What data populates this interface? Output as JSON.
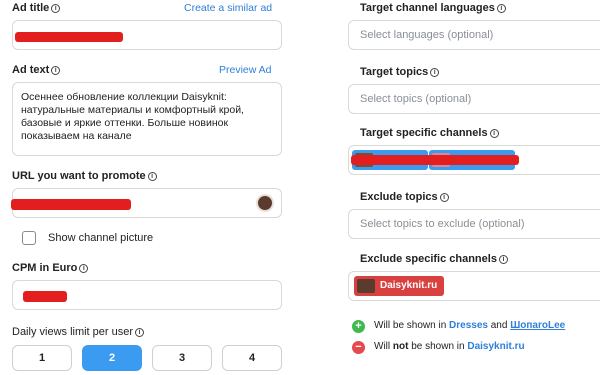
{
  "left": {
    "ad_title": {
      "label": "Ad title",
      "link": "Create a similar ad"
    },
    "ad_text": {
      "label": "Ad text",
      "link": "Preview Ad",
      "lines": [
        "Осеннее обновление коллекции Daisyknit:",
        "натуральные материалы и комфортный крой,",
        "базовые и яркие оттенки. Больше новинок",
        "показываем на канале"
      ]
    },
    "url": {
      "label": "URL you want to promote"
    },
    "show_picture": {
      "label": "Show channel picture",
      "checked": false
    },
    "cpm": {
      "label": "CPM in Euro"
    },
    "daily_limit": {
      "label": "Daily views limit per user",
      "options": [
        "1",
        "2",
        "3",
        "4"
      ],
      "selected": "2"
    }
  },
  "right": {
    "languages": {
      "label": "Target channel languages",
      "placeholder": "Select languages (optional)"
    },
    "topics": {
      "label": "Target topics",
      "placeholder": "Select topics (optional)"
    },
    "channels": {
      "label": "Target specific channels"
    },
    "exclude_topics": {
      "label": "Exclude topics",
      "placeholder": "Select topics to exclude (optional)"
    },
    "exclude_channels": {
      "label": "Exclude specific channels",
      "chip": "Daisyknit.ru"
    },
    "shown": {
      "prefix": "Will be shown in",
      "a": "Dresses",
      "and": "and",
      "b": "ШопаroLee"
    },
    "not_shown": {
      "prefix": "Will",
      "not": "not",
      "middle": "be shown in",
      "channel": "Daisyknit.ru"
    }
  },
  "colors": {
    "accent": "#3a9bf0",
    "redaction": "#e31e1e",
    "link": "#2f7fd8"
  }
}
